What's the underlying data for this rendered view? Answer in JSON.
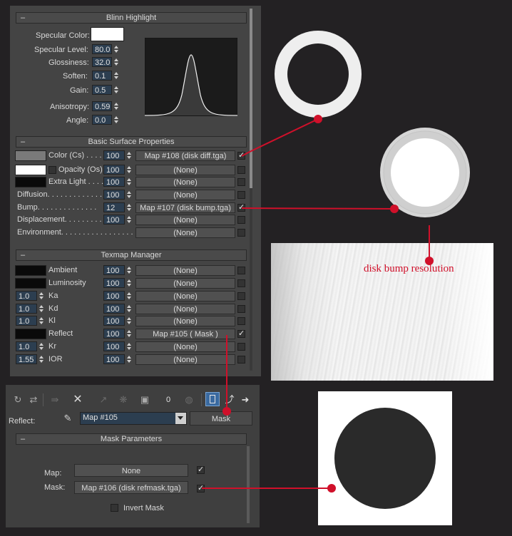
{
  "blinn": {
    "title": "Blinn Highlight",
    "spec_color_label": "Specular Color:",
    "spec_level_label": "Specular Level:",
    "spec_level": "80.0",
    "glossiness_label": "Glossiness:",
    "glossiness": "32.0",
    "soften_label": "Soften:",
    "soften": "0.1",
    "gain_label": "Gain:",
    "gain": "0.5",
    "aniso_label": "Anisotropy:",
    "aniso": "0.59",
    "angle_label": "Angle:",
    "angle": "0.0"
  },
  "surface": {
    "title": "Basic Surface Properties",
    "rows": [
      {
        "label": "Color (Cs) . . . . .",
        "amount": "100",
        "map": "Map #108 (disk diff.tga)",
        "checked": true
      },
      {
        "label": "Opacity (Os)",
        "amount": "100",
        "map": "(None)",
        "checked": false
      },
      {
        "label": "Extra Light . . . .",
        "amount": "100",
        "map": "(None)",
        "checked": false
      },
      {
        "label": "Diffusion. . . . . . . . . . . . .",
        "amount": "100",
        "map": "(None)",
        "checked": false
      },
      {
        "label": "Bump. . . . . . . . . . . . . .",
        "amount": "12",
        "map": "Map #107 (disk bump.tga)",
        "checked": true
      },
      {
        "label": "Displacement. . . . . . . . .",
        "amount": "100",
        "map": "(None)",
        "checked": false
      },
      {
        "label": "Environment. . . . . . . . . . . . . . . . .",
        "amount": "",
        "map": "(None)",
        "checked": false
      }
    ]
  },
  "texmap": {
    "title": "Texmap Manager",
    "rows": [
      {
        "value": "",
        "label": "Ambient",
        "amount": "100",
        "map": "(None)",
        "checked": false
      },
      {
        "value": "",
        "label": "Luminosity",
        "amount": "100",
        "map": "(None)",
        "checked": false
      },
      {
        "value": "1.0",
        "label": "Ka",
        "amount": "100",
        "map": "(None)",
        "checked": false
      },
      {
        "value": "1.0",
        "label": "Kd",
        "amount": "100",
        "map": "(None)",
        "checked": false
      },
      {
        "value": "1.0",
        "label": "Kl",
        "amount": "100",
        "map": "(None)",
        "checked": false
      },
      {
        "value": "",
        "label": "Reflect",
        "amount": "100",
        "map": "Map #105  ( Mask )",
        "checked": true
      },
      {
        "value": "1.0",
        "label": "Kr",
        "amount": "100",
        "map": "(None)",
        "checked": false
      },
      {
        "value": "1.55",
        "label": "IOR",
        "amount": "100",
        "map": "(None)",
        "checked": false
      }
    ]
  },
  "toolbar": {
    "slot_label": "Reflect:",
    "map_name": "Map #105",
    "type_button": "Mask",
    "zero_label": "0"
  },
  "mask": {
    "title": "Mask Parameters",
    "map_label": "Map:",
    "map_value": "None",
    "mask_label": "Mask:",
    "mask_value": "Map #106 (disk refmask.tga)",
    "invert_label": "Invert Mask",
    "map_checked": true,
    "mask_checked": true,
    "invert_checked": false
  },
  "annotation": {
    "text": "disk bump resolution"
  },
  "colors": {
    "accent_red": "#d0102a",
    "spinner_bg": "#2c3e50",
    "panel_bg": "#444444"
  }
}
